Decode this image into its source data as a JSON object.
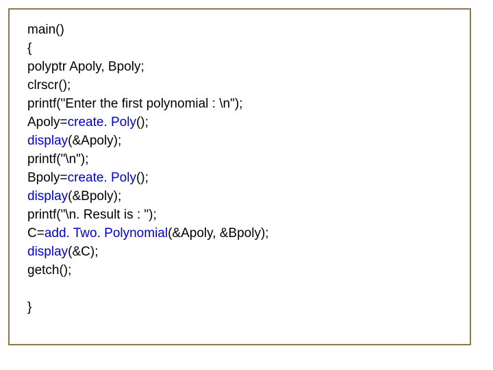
{
  "code": {
    "l1_main": "main()",
    "l2_brace": "{",
    "l3_decl": "polyptr Apoly, Bpoly;",
    "l4_clrscr": "clrscr();",
    "l5_printf1": "printf(\"Enter the first polynomial : \\n\");",
    "l6a": "Apoly=",
    "l6b_fn": "create. Poly",
    "l6c": "();",
    "l7a_fn": "display",
    "l7b": "(&Apoly);",
    "l8_printf2": "printf(\"\\n\");",
    "l9a": "Bpoly=",
    "l9b_fn": "create. Poly",
    "l9c": "();",
    "l10a_fn": "display",
    "l10b": "(&Bpoly);",
    "l11_printf3": "printf(\"\\n. Result is : \");",
    "l12a": "C=",
    "l12b_fn": "add. Two. Polynomial",
    "l12c": "(&Apoly, &Bpoly);",
    "l13a_fn": "display",
    "l13b": "(&C);",
    "l14_getch": "getch();",
    "l16_close": "}"
  }
}
